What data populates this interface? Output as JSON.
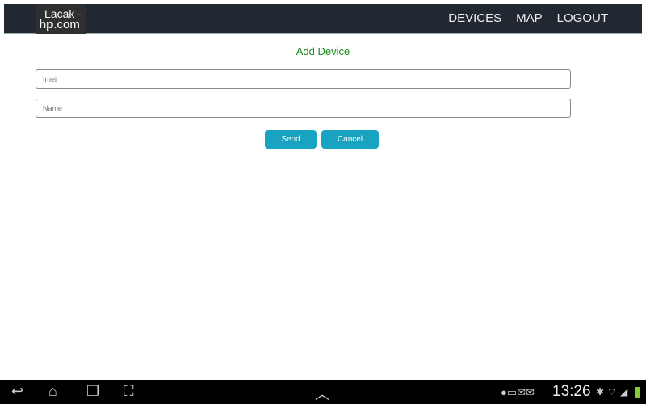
{
  "nav": {
    "logo_line1": "Lacak -",
    "logo_bold": "hp",
    "logo_rest": ".com",
    "links": [
      "DEVICES",
      "MAP",
      "LOGOUT"
    ]
  },
  "form": {
    "title": "Add Device",
    "imei_placeholder": "Imei",
    "name_placeholder": "Name",
    "send": "Send",
    "cancel": "Cancel"
  },
  "status": {
    "time": "13:26"
  }
}
